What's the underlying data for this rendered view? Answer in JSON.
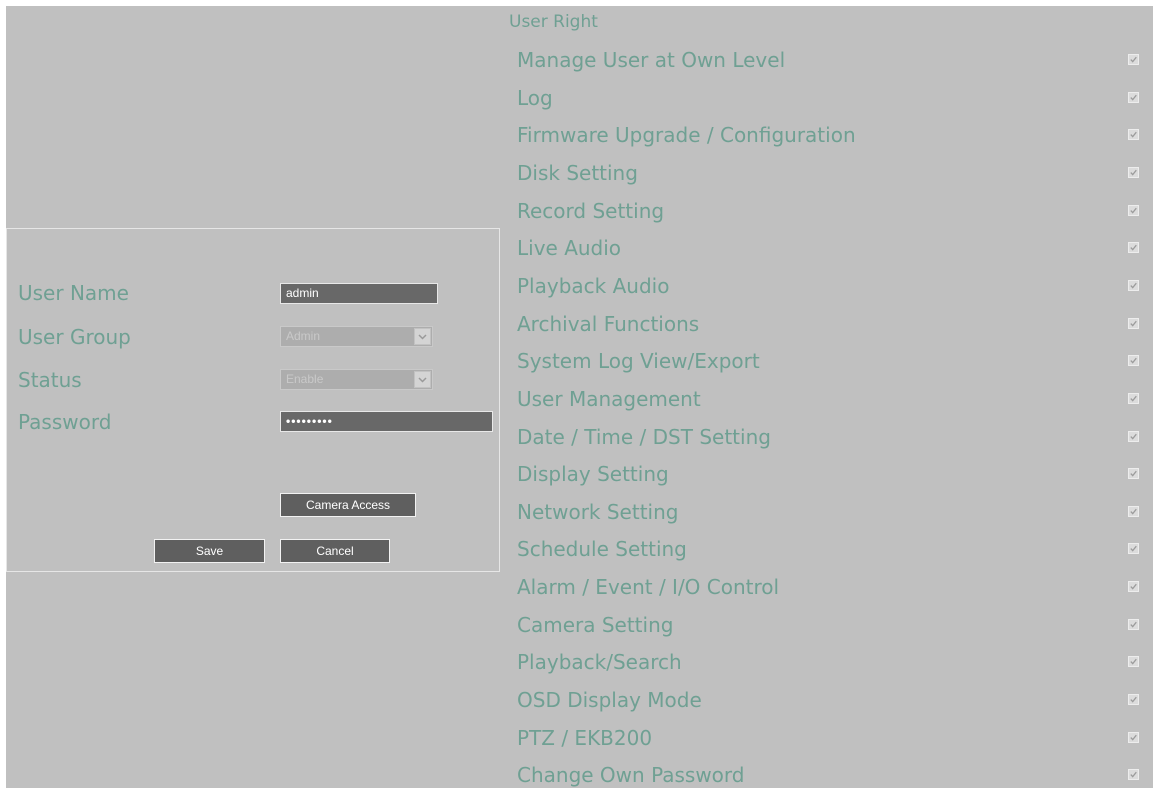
{
  "form": {
    "username_label": "User Name",
    "username_value": "admin",
    "group_label": "User Group",
    "group_value": "Admin",
    "status_label": "Status",
    "status_value": "Enable",
    "password_label": "Password",
    "password_value": "•••••••••",
    "camera_access_label": "Camera Access",
    "save_label": "Save",
    "cancel_label": "Cancel"
  },
  "rights": {
    "title": "User Right",
    "items": [
      {
        "label": "Manage User at Own Level",
        "checked": true
      },
      {
        "label": "Log",
        "checked": true
      },
      {
        "label": "Firmware Upgrade / Configuration",
        "checked": true
      },
      {
        "label": "Disk Setting",
        "checked": true
      },
      {
        "label": "Record Setting",
        "checked": true
      },
      {
        "label": "Live Audio",
        "checked": true
      },
      {
        "label": "Playback Audio",
        "checked": true
      },
      {
        "label": "Archival Functions",
        "checked": true
      },
      {
        "label": "System Log View/Export",
        "checked": true
      },
      {
        "label": "User Management",
        "checked": true
      },
      {
        "label": "Date / Time / DST Setting",
        "checked": true
      },
      {
        "label": "Display Setting",
        "checked": true
      },
      {
        "label": "Network Setting",
        "checked": true
      },
      {
        "label": "Schedule Setting",
        "checked": true
      },
      {
        "label": "Alarm / Event / I/O Control",
        "checked": true
      },
      {
        "label": "Camera Setting",
        "checked": true
      },
      {
        "label": "Playback/Search",
        "checked": true
      },
      {
        "label": "OSD Display Mode",
        "checked": true
      },
      {
        "label": "PTZ / EKB200",
        "checked": true
      },
      {
        "label": "Change Own Password",
        "checked": true
      }
    ]
  }
}
